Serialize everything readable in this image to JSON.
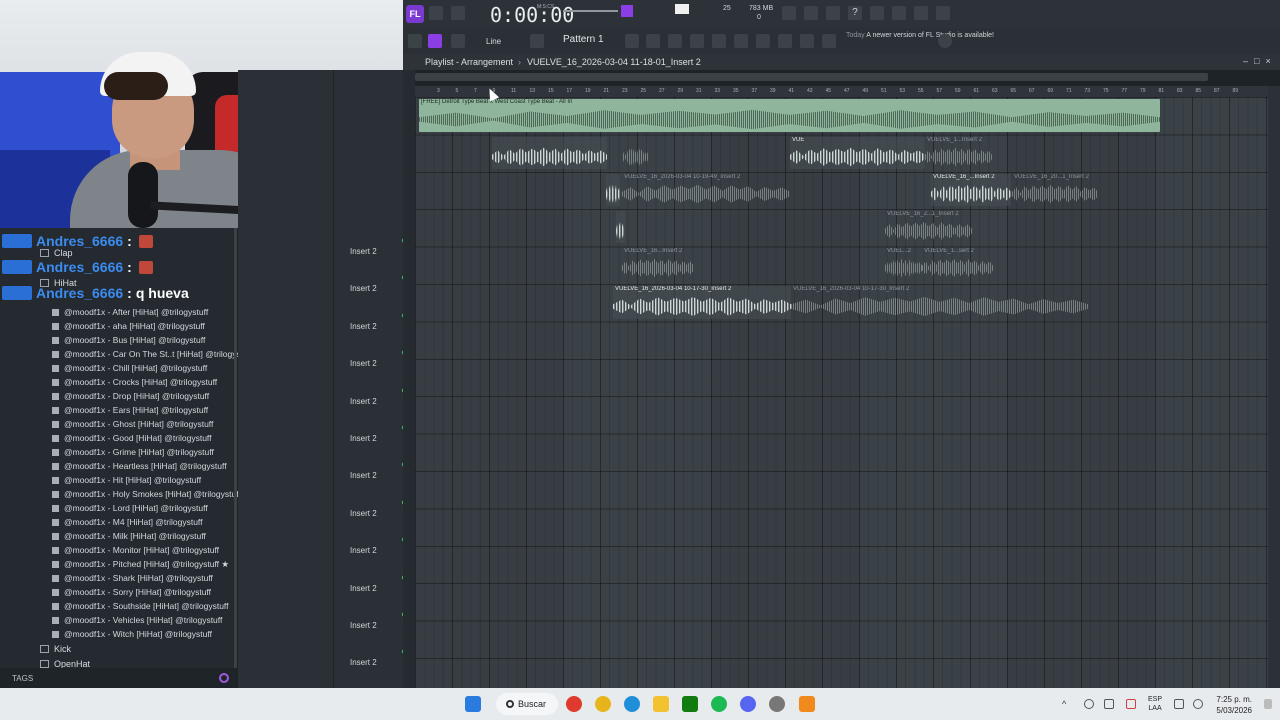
{
  "chat": [
    {
      "user": "Andres_6666",
      "sep": ":",
      "message": ""
    },
    {
      "user": "Andres_6666",
      "sep": ":",
      "message": ""
    },
    {
      "user": "Andres_6666",
      "sep": ":",
      "message": "q hueva"
    }
  ],
  "browser": {
    "folders_top": [
      "Clap",
      "HiHat"
    ],
    "files": [
      "@moodf1x - After [HiHat] @trilogystuff",
      "@moodf1x - aha [HiHat] @trilogystuff",
      "@moodf1x - Bus [HiHat] @trilogystuff",
      "@moodf1x - Car On The St..t [HiHat] @trilogystuff",
      "@moodf1x - Chill [HiHat] @trilogystuff",
      "@moodf1x - Crocks [HiHat] @trilogystuff",
      "@moodf1x - Drop [HiHat] @trilogystuff",
      "@moodf1x - Ears [HiHat] @trilogystuff",
      "@moodf1x - Ghost [HiHat] @trilogystuff",
      "@moodf1x - Good [HiHat] @trilogystuff",
      "@moodf1x - Grime [HiHat] @trilogystuff",
      "@moodf1x - Heartless [HiHat] @trilogystuff",
      "@moodf1x - Hit [HiHat] @trilogystuff",
      "@moodf1x - Holy Smokes [HiHat] @trilogystuff",
      "@moodf1x - Lord [HiHat] @trilogystuff",
      "@moodf1x - M4 [HiHat] @trilogystuff",
      "@moodf1x - Milk [HiHat] @trilogystuff",
      "@moodf1x - Monitor [HiHat] @trilogystuff",
      "@moodf1x - Pitched [HiHat] @trilogystuff ★",
      "@moodf1x - Shark [HiHat] @trilogystuff",
      "@moodf1x - Sorry [HiHat] @trilogystuff",
      "@moodf1x - Southside [HiHat] @trilogystuff",
      "@moodf1x - Vehicles [HiHat] @trilogystuff",
      "@moodf1x - Witch [HiHat] @trilogystuff"
    ],
    "folders_bottom": [
      "Kick",
      "OpenHat"
    ],
    "tags_label": "TAGS"
  },
  "toolbar": {
    "time": "0:00:00",
    "time_unit": "M:S:CS",
    "cpu": "25",
    "memory": "783 MB",
    "polyphony": "0",
    "line_mode": "Line",
    "pattern": "Pattern 1",
    "update_today": "Today",
    "update_text": "A newer version of FL Studio is available!"
  },
  "playlist": {
    "title": "Playlist - Arrangement",
    "arrow": "›",
    "file": "VUELVE_16_2026-03-04 11-18-01_Insert 2"
  },
  "ruler_marks": [
    "3",
    "5",
    "7",
    "9",
    "11",
    "13",
    "15",
    "17",
    "19",
    "21",
    "23",
    "25",
    "27",
    "29",
    "31",
    "33",
    "35",
    "37",
    "39",
    "41",
    "43",
    "45",
    "47",
    "49",
    "51",
    "53",
    "55",
    "57",
    "59",
    "61",
    "63",
    "65",
    "67",
    "69",
    "71",
    "73",
    "75",
    "77",
    "79",
    "81",
    "83",
    "85",
    "87",
    "89"
  ],
  "tracks": [
    "Insert 2",
    "Insert 2",
    "Insert 2",
    "Insert 2",
    "Insert 2",
    "Insert 2",
    "Insert 2",
    "Insert 2",
    "Insert 2",
    "Insert 2",
    "Insert 2",
    "Insert 2"
  ],
  "clips": {
    "main": "[FREE] Detroit Type Beat x West Coast Type Beat - All In",
    "c1": "VUELVE_16_2026-03-04 10-19-49_Insert 2",
    "c2": "VUELVE_16_2026-03-04 10-19-49_Insert 2",
    "c3": "VUE",
    "c4": "VUELVE_1...Insert 2",
    "c5": "VUELVE_16_...Insert 2",
    "c6": "VUELVE_16_20...1_Insert 2",
    "c7": "VUELVE_16_2...1_Insert 2",
    "c8": "VUELVE_16...Insert 2",
    "c9": "VUEL...2",
    "c10": "VUELVE_1...sert 2",
    "c11": "VUELVE_16_2026-03-04 10-17-30_Insert 2",
    "c12": "VUELVE_16_2026-03-04 10-17-30_Insert 2"
  },
  "taskbar": {
    "search": "Buscar",
    "lang1": "ESP",
    "lang2": "LAA",
    "time": "7:25 p. m.",
    "date": "5/03/2026"
  }
}
